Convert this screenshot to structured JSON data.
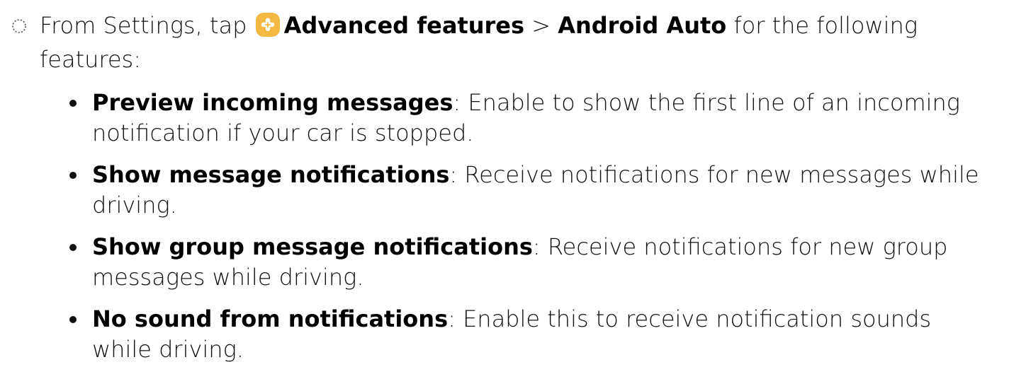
{
  "step": {
    "prefix": "From Settings, tap",
    "icon": "advanced-features-icon",
    "menu_item_1": "Advanced features",
    "separator": ">",
    "menu_item_2": "Android Auto",
    "suffix": "for the following features:"
  },
  "features": [
    {
      "title": "Preview incoming messages",
      "description": ": Enable to show the first line of an incoming notification if your car is stopped."
    },
    {
      "title": "Show message notifications",
      "description": ": Receive notifications for new messages while driving."
    },
    {
      "title": "Show group message notifications",
      "description": ": Receive notifications for new group messages while driving."
    },
    {
      "title": "No sound from notifications",
      "description": ": Enable this to receive notification sounds while driving."
    }
  ],
  "colors": {
    "icon_bg": "#F4B942",
    "icon_fg": "#FFFFFF",
    "text": "#111111"
  }
}
